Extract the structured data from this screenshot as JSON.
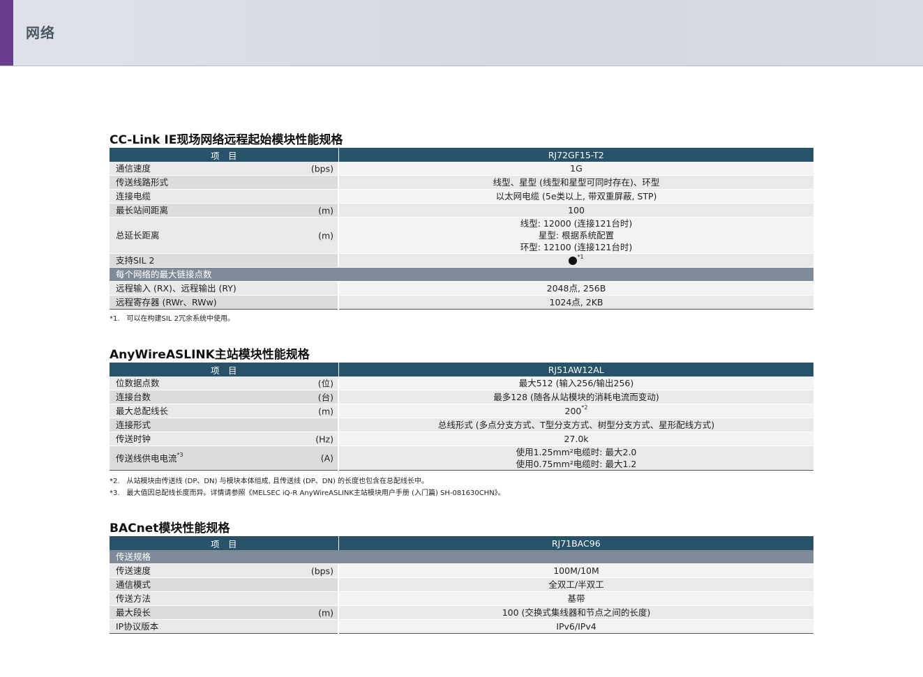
{
  "header": {
    "title": "网络"
  },
  "common": {
    "item_header": "项　目"
  },
  "cclink": {
    "title": "CC-Link IE现场网络远程起始模块性能规格",
    "model": "RJ72GF15-T2",
    "rows": [
      {
        "label": "通信速度",
        "unit": "(bps)",
        "value": "1G"
      },
      {
        "label": "传送线路形式",
        "unit": "",
        "value": "线型、星型 (线型和星型可同时存在)、环型"
      },
      {
        "label": "连接电缆",
        "unit": "",
        "value": "以太网电缆 (5e类以上, 带双重屏蔽, STP)"
      },
      {
        "label": "最长站间距离",
        "unit": "(m)",
        "value": "100"
      }
    ],
    "total_length": {
      "label": "总延长距离",
      "unit": "(m)",
      "line1": "线型: 12000 (连接121台时)",
      "line2": "星型: 根据系统配置",
      "line3": "环型: 12100 (连接121台时)"
    },
    "sil": {
      "label": "支持SIL 2",
      "note_ref": "*1"
    },
    "group": "每个网络的最大链接点数",
    "rows2": [
      {
        "label": "远程输入 (RX)、远程输出 (RY)",
        "value": "2048点, 256B"
      },
      {
        "label": "远程寄存器 (RWr、RWw)",
        "value": "1024点, 2KB"
      }
    ],
    "notes": [
      "*1.　可以在构建SIL 2冗余系统中使用。"
    ]
  },
  "anywire": {
    "title": "AnyWireASLINK主站模块性能规格",
    "model": "RJ51AW12AL",
    "rows": [
      {
        "label": "位数据点数",
        "unit": "(位)",
        "value": "最大512 (输入256/输出256)"
      },
      {
        "label": "连接台数",
        "unit": "(台)",
        "value": "最多128 (随各从站模块的消耗电流而变动)"
      }
    ],
    "max_length": {
      "label": "最大总配线长",
      "unit": "(m)",
      "value": "200",
      "ref": "*2"
    },
    "rows2": [
      {
        "label": "连接形式",
        "unit": "",
        "value": "总线形式 (多点分支方式、T型分支方式、树型分支方式、星形配线方式)"
      },
      {
        "label": "传送时钟",
        "unit": "(Hz)",
        "value": "27.0k"
      }
    ],
    "current": {
      "label": "传送线供电电流",
      "ref": "*3",
      "unit": "(A)",
      "line1": "使用1.25mm²电缆时: 最大2.0",
      "line2": "使用0.75mm²电缆时: 最大1.2"
    },
    "notes": [
      "*2.　从站模块由传送线 (DP、DN) 与模块本体组成, 且传送线 (DP、DN) 的长度也包含在总配线长中。",
      "*3.　最大值因总配线长度而异。详情请参照《MELSEC iQ-R AnyWireASLINK主站模块用户手册 (入门篇) SH-081630CHN》。"
    ]
  },
  "bacnet": {
    "title": "BACnet模块性能规格",
    "model": "RJ71BAC96",
    "group": "传送规格",
    "rows": [
      {
        "label": "传送速度",
        "unit": "(bps)",
        "value": "100M/10M"
      },
      {
        "label": "通信模式",
        "unit": "",
        "value": "全双工/半双工"
      },
      {
        "label": "传送方法",
        "unit": "",
        "value": "基带"
      },
      {
        "label": "最大段长",
        "unit": "(m)",
        "value": "100 (交换式集线器和节点之间的长度)"
      },
      {
        "label": "IP协议版本",
        "unit": "",
        "value": "IPv6/IPv4"
      }
    ]
  }
}
